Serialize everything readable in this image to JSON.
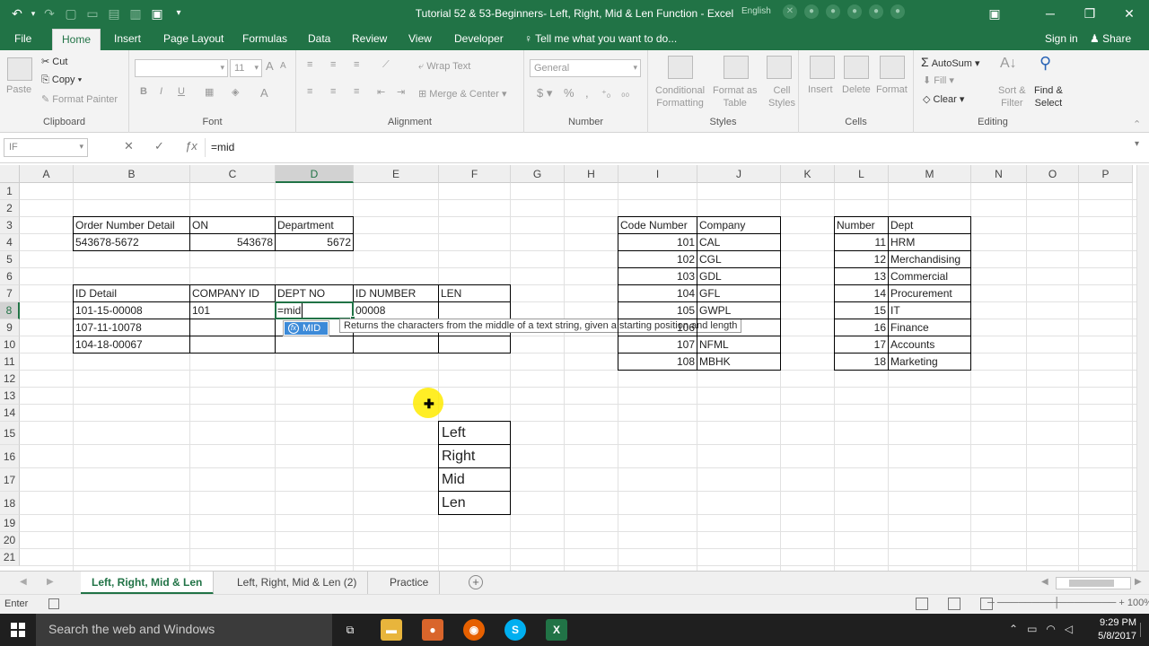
{
  "window": {
    "title": "Tutorial 52 & 53-Beginners- Left, Right, Mid & Len Function - Excel",
    "language_badge": "English"
  },
  "colors": {
    "accent": "#217346",
    "selection": "#3c8ad8",
    "cursor_highlight": "#ffeb00"
  },
  "ribbon_tabs": [
    "File",
    "Home",
    "Insert",
    "Page Layout",
    "Formulas",
    "Data",
    "Review",
    "View",
    "Developer"
  ],
  "tell_me": "Tell me what you want to do...",
  "account": {
    "signin": "Sign in",
    "share": "Share"
  },
  "ribbon": {
    "clipboard": {
      "label": "Clipboard",
      "paste": "Paste",
      "cut": "Cut",
      "copy": "Copy",
      "format_painter": "Format Painter"
    },
    "font": {
      "label": "Font",
      "size": "11"
    },
    "alignment": {
      "label": "Alignment",
      "wrap_text": "Wrap Text",
      "merge_center": "Merge & Center"
    },
    "number": {
      "label": "Number",
      "format": "General"
    },
    "styles": {
      "label": "Styles",
      "conditional_1": "Conditional",
      "conditional_2": "Formatting",
      "format_as_1": "Format as",
      "format_as_2": "Table",
      "cell_1": "Cell",
      "cell_2": "Styles"
    },
    "cells": {
      "label": "Cells",
      "insert": "Insert",
      "delete": "Delete",
      "format": "Format"
    },
    "editing": {
      "label": "Editing",
      "autosum": "AutoSum",
      "fill": "Fill",
      "clear": "Clear",
      "sort_1": "Sort &",
      "sort_2": "Filter",
      "find_1": "Find &",
      "find_2": "Select"
    }
  },
  "formula_bar": {
    "name_box": "IF",
    "formula": "=mid"
  },
  "columns": [
    "A",
    "B",
    "C",
    "D",
    "E",
    "F",
    "G",
    "H",
    "I",
    "J",
    "K",
    "L",
    "M",
    "N",
    "O",
    "P"
  ],
  "selected_column": "D",
  "rows": [
    "1",
    "2",
    "3",
    "4",
    "5",
    "6",
    "7",
    "8",
    "9",
    "10",
    "11",
    "12",
    "13",
    "14",
    "15",
    "16",
    "17",
    "18",
    "19",
    "20",
    "21"
  ],
  "selected_row": "8",
  "table1": {
    "headers": [
      "Order Number Detail",
      "ON",
      "Department"
    ],
    "row": [
      "543678-5672",
      "543678",
      "5672"
    ]
  },
  "table2": {
    "headers": [
      "ID Detail",
      "COMPANY ID",
      "DEPT NO",
      "ID NUMBER",
      "LEN"
    ],
    "rows": [
      [
        "101-15-00008",
        "101",
        "=mid",
        "00008",
        ""
      ],
      [
        "107-11-10078",
        "",
        "",
        "",
        ""
      ],
      [
        "104-18-00067",
        "",
        "",
        "",
        ""
      ]
    ]
  },
  "autocomplete": {
    "item": "MID",
    "tooltip": "Returns the characters from the middle of a text string, given a starting position and length"
  },
  "functions_list": [
    "Left",
    "Right",
    "Mid",
    "Len"
  ],
  "table3": {
    "headers": [
      "Code Number",
      "Company"
    ],
    "rows": [
      [
        "101",
        "CAL"
      ],
      [
        "102",
        "CGL"
      ],
      [
        "103",
        "GDL"
      ],
      [
        "104",
        "GFL"
      ],
      [
        "105",
        "GWPL"
      ],
      [
        "106",
        ""
      ],
      [
        "107",
        "NFML"
      ],
      [
        "108",
        "MBHK"
      ]
    ]
  },
  "table4": {
    "headers": [
      "Number",
      "Dept"
    ],
    "rows": [
      [
        "11",
        "HRM"
      ],
      [
        "12",
        "Merchandising"
      ],
      [
        "13",
        "Commercial"
      ],
      [
        "14",
        "Procurement"
      ],
      [
        "15",
        "IT"
      ],
      [
        "16",
        "Finance"
      ],
      [
        "17",
        "Accounts"
      ],
      [
        "18",
        "Marketing"
      ]
    ]
  },
  "sheet_tabs": [
    "Left, Right, Mid & Len",
    "Left, Right, Mid & Len  (2)",
    "Practice"
  ],
  "status": {
    "mode": "Enter",
    "zoom": "100%"
  },
  "taskbar": {
    "search": "Search the web and Windows",
    "time": "9:29 PM",
    "date": "5/8/2017"
  }
}
